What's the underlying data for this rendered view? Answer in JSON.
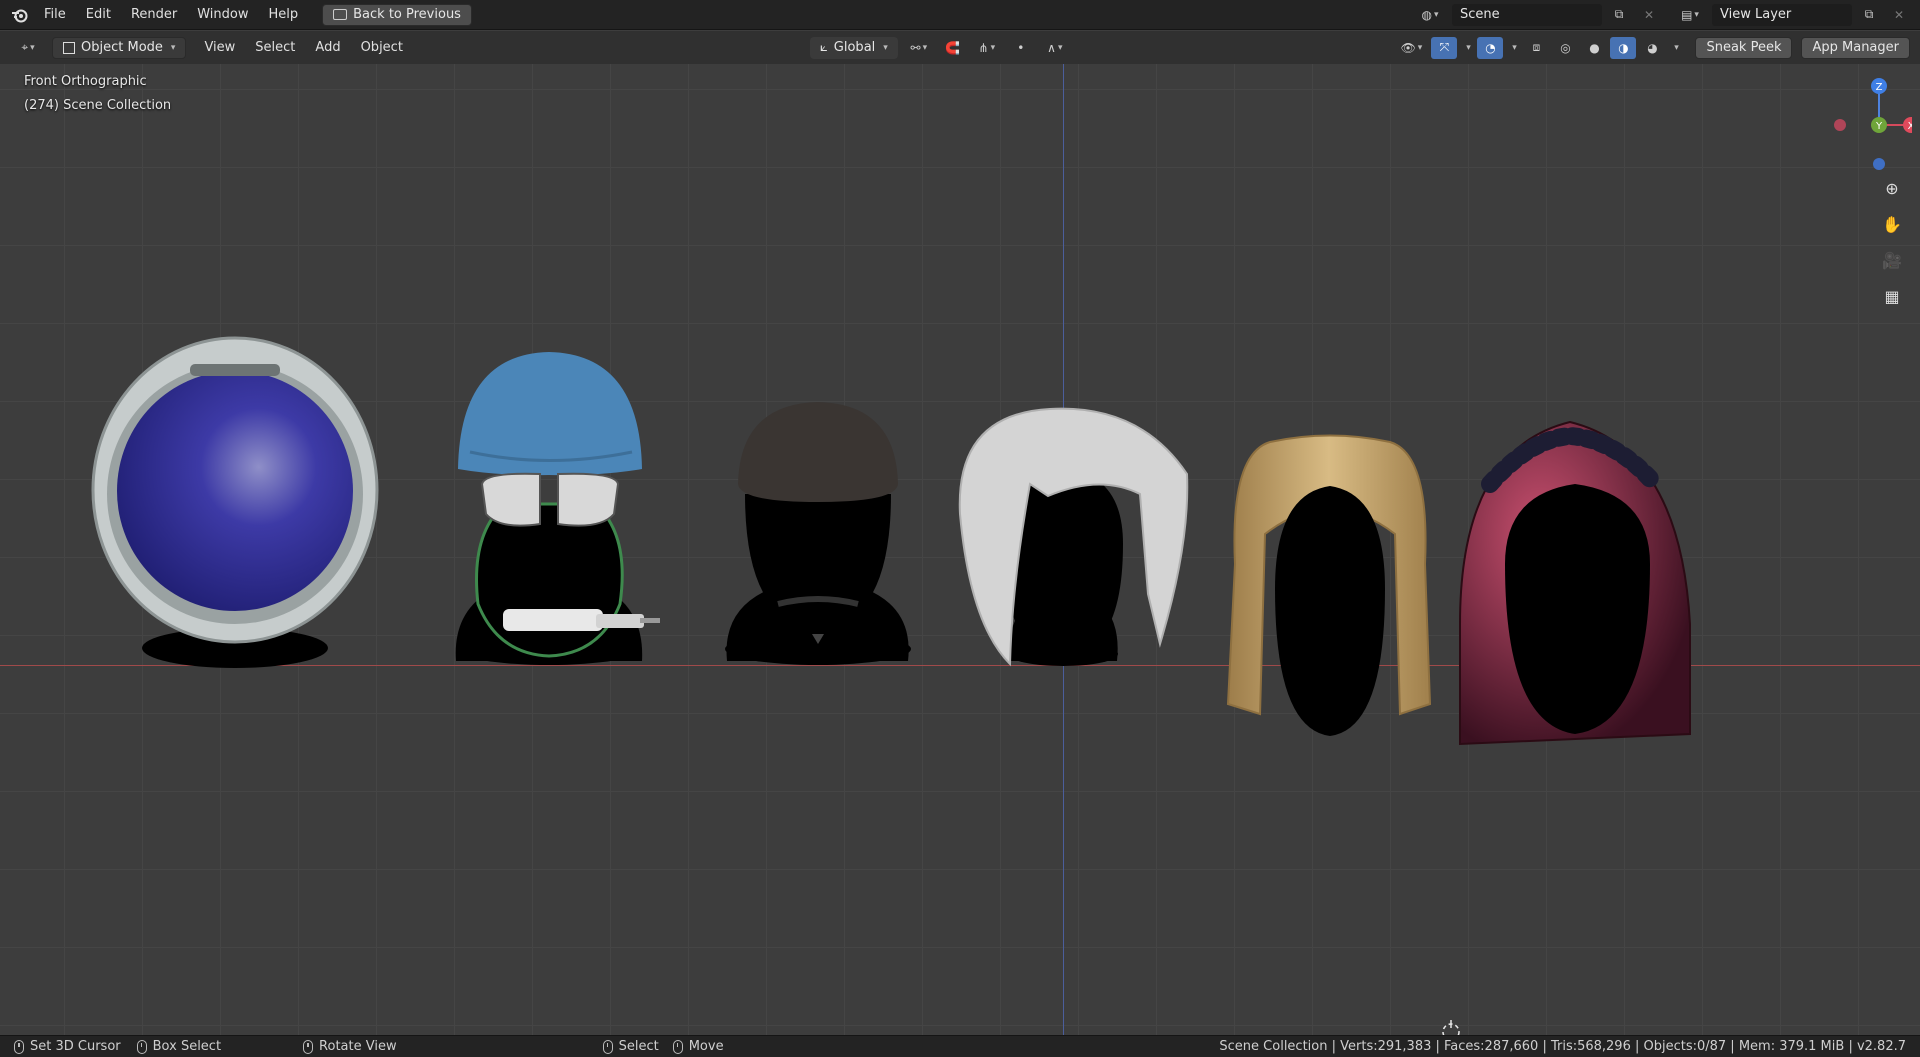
{
  "topbar": {
    "menus": [
      "File",
      "Edit",
      "Render",
      "Window",
      "Help"
    ],
    "back_button": "Back to Previous",
    "scene_name": "Scene",
    "view_layer_name": "View Layer"
  },
  "header": {
    "mode": "Object Mode",
    "menus": [
      "View",
      "Select",
      "Add",
      "Object"
    ],
    "transform_orientation": "Global",
    "buttons": {
      "sneak_peek": "Sneak Peek",
      "app_manager": "App Manager"
    }
  },
  "viewport": {
    "view_name": "Front Orthographic",
    "collection_info": "(274) Scene Collection",
    "gizmo": {
      "z": "Z",
      "y": "Y",
      "x": "X"
    }
  },
  "statusbar": {
    "left": [
      {
        "label": "Set 3D Cursor"
      },
      {
        "label": "Box Select"
      },
      {
        "label": "Rotate View"
      }
    ],
    "mid": [
      {
        "label": "Select"
      },
      {
        "label": "Move"
      }
    ],
    "stats": "Scene Collection | Verts:291,383 | Faces:287,660 | Tris:568,296 | Objects:0/87 | Mem: 379.1 MiB | v2.82.7"
  },
  "colors": {
    "helmet_visor": "#2e2c8c",
    "climbing_helmet": "#4b86b8",
    "cap": "#3a3532",
    "white_hair": "#d4d4d4",
    "blonde_hair": "#c9a86e",
    "curly_hair": "#8a2a45",
    "active_blue": "#4772b3"
  },
  "icons": [
    "blender-logo-icon",
    "back-icon",
    "scene-icon",
    "new-scene-icon",
    "close-icon",
    "view-layer-icon",
    "editor-type-icon",
    "object-mode-icon",
    "orientation-icon",
    "pivot-icon",
    "snap-icon",
    "proportional-icon",
    "visibility-icon",
    "gizmo-icon",
    "overlay-icon",
    "xray-icon",
    "wireframe-icon",
    "solid-icon",
    "material-icon",
    "rendered-icon",
    "zoom-icon",
    "hand-icon",
    "camera-icon",
    "grid-icon"
  ]
}
